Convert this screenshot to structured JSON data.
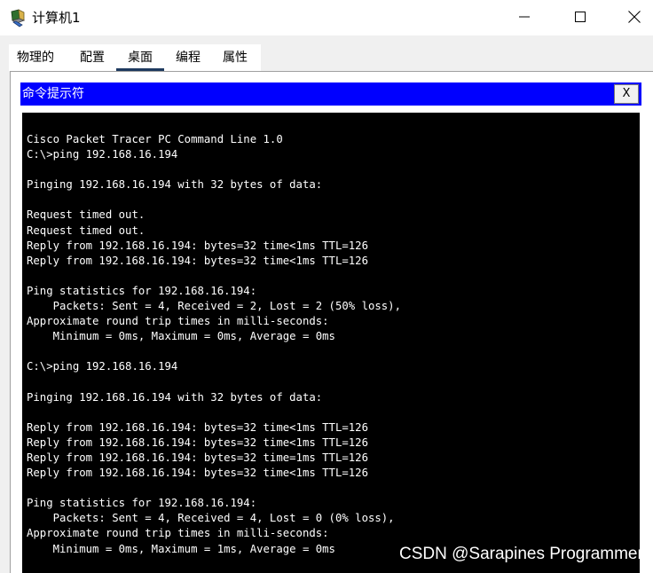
{
  "window": {
    "title": "计算机1",
    "controls": {
      "minimize": "─",
      "maximize": "☐",
      "close": "✕"
    }
  },
  "tabs": [
    {
      "label": "物理的"
    },
    {
      "label": "配置"
    },
    {
      "label": "桌面",
      "active": true
    },
    {
      "label": "编程"
    },
    {
      "label": "属性"
    }
  ],
  "command_prompt": {
    "title": "命令提示符",
    "close_label": "X",
    "output": "Cisco Packet Tracer PC Command Line 1.0\nC:\\>ping 192.168.16.194\n\nPinging 192.168.16.194 with 32 bytes of data:\n\nRequest timed out.\nRequest timed out.\nReply from 192.168.16.194: bytes=32 time<1ms TTL=126\nReply from 192.168.16.194: bytes=32 time<1ms TTL=126\n\nPing statistics for 192.168.16.194:\n    Packets: Sent = 4, Received = 2, Lost = 2 (50% loss),\nApproximate round trip times in milli-seconds:\n    Minimum = 0ms, Maximum = 0ms, Average = 0ms\n\nC:\\>ping 192.168.16.194\n\nPinging 192.168.16.194 with 32 bytes of data:\n\nReply from 192.168.16.194: bytes=32 time<1ms TTL=126\nReply from 192.168.16.194: bytes=32 time<1ms TTL=126\nReply from 192.168.16.194: bytes=32 time=1ms TTL=126\nReply from 192.168.16.194: bytes=32 time<1ms TTL=126\n\nPing statistics for 192.168.16.194:\n    Packets: Sent = 4, Received = 4, Lost = 0 (0% loss),\nApproximate round trip times in milli-seconds:\n    Minimum = 0ms, Maximum = 1ms, Average = 0ms"
  },
  "watermark": "CSDN @Sarapines Programmer",
  "colors": {
    "cmd_header": "#0000ff",
    "terminal_bg": "#000000",
    "terminal_fg": "#ffffff",
    "tab_active_underline": "#1e3a5f"
  },
  "icons": {
    "app_icon": "packet-tracer-pc-icon"
  }
}
